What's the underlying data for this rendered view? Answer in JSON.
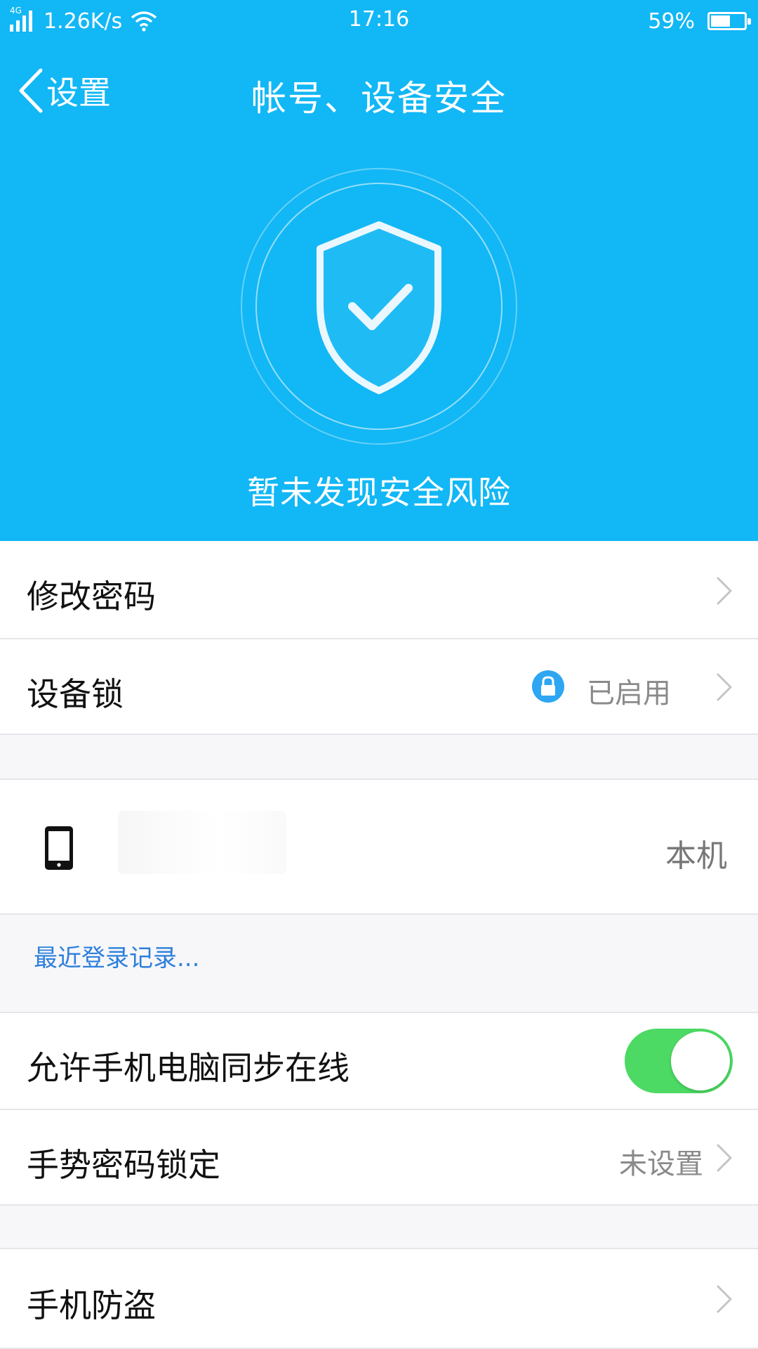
{
  "status_bar": {
    "network": "4G",
    "speed": "1.26K/s",
    "time": "17:16",
    "battery_percent": "59%",
    "battery_level": 0.59
  },
  "nav": {
    "back_label": "设置",
    "title": "帐号、设备安全"
  },
  "hero": {
    "status_text": "暂未发现安全风险",
    "icon": "shield-check-icon"
  },
  "rows": {
    "change_password": {
      "label": "修改密码"
    },
    "device_lock": {
      "label": "设备锁",
      "value": "已启用",
      "icon": "lock-icon"
    },
    "current_device": {
      "value": "本机",
      "icon": "phone-icon"
    },
    "recent_login": {
      "label": "最近登录记录..."
    },
    "sync_online": {
      "label": "允许手机电脑同步在线",
      "enabled": true
    },
    "gesture_lock": {
      "label": "手势密码锁定",
      "value": "未设置"
    },
    "anti_theft": {
      "label": "手机防盗"
    }
  },
  "colors": {
    "header_bg": "#12b7f5",
    "toggle_on": "#4cd964",
    "link": "#2d7fdc",
    "lock_badge": "#2ea6f3"
  }
}
